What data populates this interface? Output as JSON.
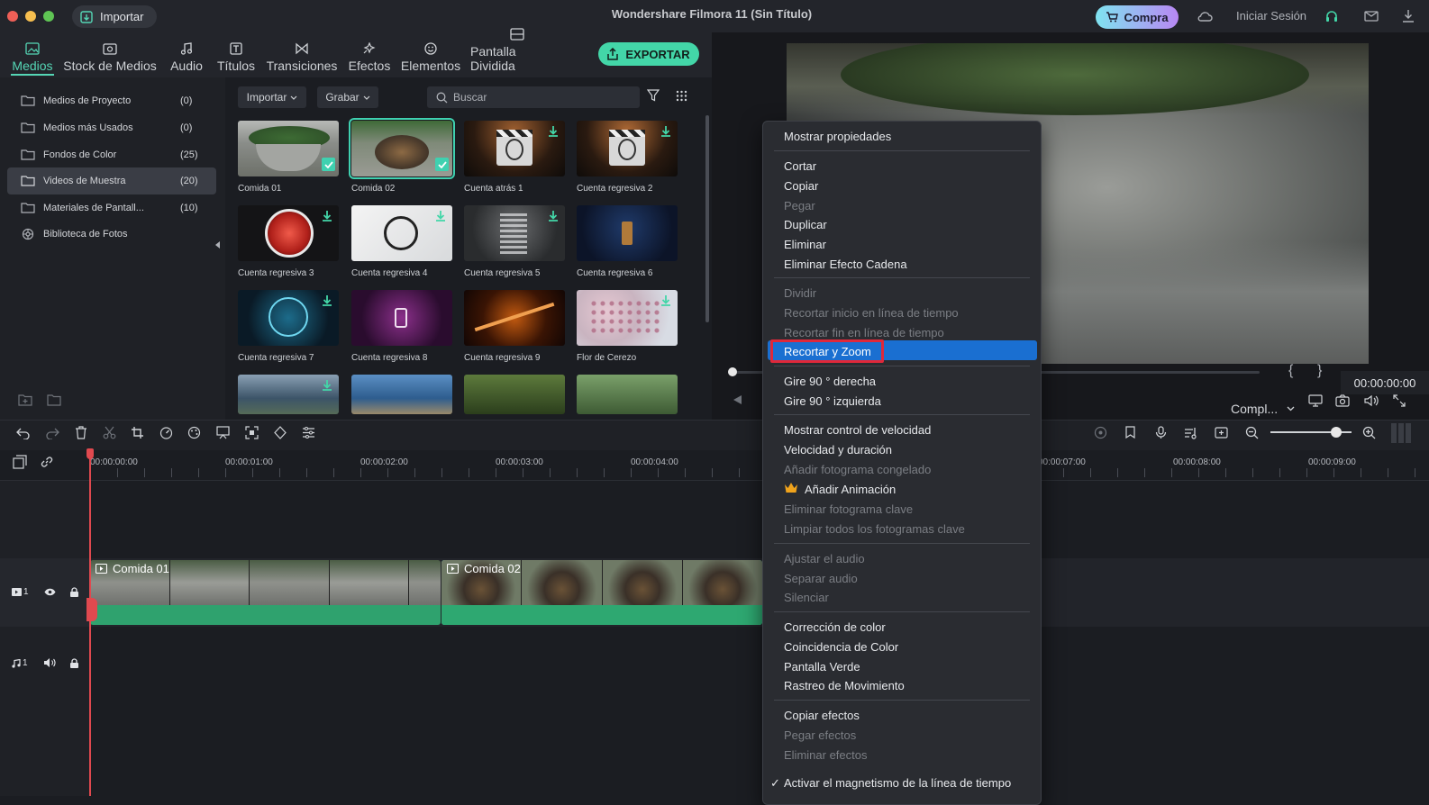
{
  "titlebar": {
    "import_label": "Importar",
    "app_title": "Wondershare Filmora 11 (Sin Título)",
    "buy_label": "Compra",
    "login_label": "Iniciar Sesión"
  },
  "nav": {
    "tabs": [
      {
        "label": "Medios",
        "icon": "media-icon"
      },
      {
        "label": "Stock de Medios",
        "icon": "stock-media-icon"
      },
      {
        "label": "Audio",
        "icon": "audio-icon"
      },
      {
        "label": "Títulos",
        "icon": "titles-icon"
      },
      {
        "label": "Transiciones",
        "icon": "transitions-icon"
      },
      {
        "label": "Efectos",
        "icon": "effects-icon"
      },
      {
        "label": "Elementos",
        "icon": "elements-icon"
      },
      {
        "label": "Pantalla Dividida",
        "icon": "split-screen-icon"
      }
    ],
    "export_label": "EXPORTAR"
  },
  "sidebar": {
    "items": [
      {
        "label": "Medios de Proyecto",
        "count": "(0)"
      },
      {
        "label": "Medios más Usados",
        "count": "(0)"
      },
      {
        "label": "Fondos de Color",
        "count": "(25)"
      },
      {
        "label": "Videos de Muestra",
        "count": "(20)"
      },
      {
        "label": "Materiales de Pantall...",
        "count": "(10)"
      },
      {
        "label": "Biblioteca de Fotos",
        "count": ""
      }
    ]
  },
  "media": {
    "import_dd": "Importar",
    "record_dd": "Grabar",
    "search_placeholder": "Buscar",
    "items": [
      {
        "caption": "Comida 01"
      },
      {
        "caption": "Comida 02"
      },
      {
        "caption": "Cuenta atrás 1"
      },
      {
        "caption": "Cuenta regresiva 2"
      },
      {
        "caption": "Cuenta regresiva 3"
      },
      {
        "caption": "Cuenta regresiva 4"
      },
      {
        "caption": "Cuenta regresiva 5"
      },
      {
        "caption": "Cuenta regresiva 6"
      },
      {
        "caption": "Cuenta regresiva 7"
      },
      {
        "caption": "Cuenta regresiva 8"
      },
      {
        "caption": "Cuenta regresiva 9"
      },
      {
        "caption": "Flor de Cerezo"
      }
    ]
  },
  "preview": {
    "timecode": "00:00:00:00",
    "quality": "Compl...",
    "bracket_in": "{",
    "bracket_out": "}"
  },
  "timeline": {
    "ticks": [
      "00:00:00:00",
      "00:00:01:00",
      "00:00:02:00",
      "00:00:03:00",
      "00:00:04:00",
      "00:00:07:00",
      "00:00:08:00",
      "00:00:09:00"
    ],
    "video_track_label": "1",
    "audio_track_label": "1",
    "clips": [
      {
        "title": "Comida 01"
      },
      {
        "title": "Comida 02"
      }
    ]
  },
  "context_menu": {
    "items": [
      {
        "label": "Mostrar propiedades",
        "enabled": true
      },
      {
        "label": "Cortar",
        "enabled": true
      },
      {
        "label": "Copiar",
        "enabled": true
      },
      {
        "label": "Pegar",
        "enabled": false
      },
      {
        "label": "Duplicar",
        "enabled": true
      },
      {
        "label": "Eliminar",
        "enabled": true
      },
      {
        "label": "Eliminar Efecto Cadena",
        "enabled": true
      },
      {
        "label": "Dividir",
        "enabled": false
      },
      {
        "label": "Recortar inicio en línea de tiempo",
        "enabled": false
      },
      {
        "label": "Recortar fin en línea de tiempo",
        "enabled": false
      },
      {
        "label": "Recortar y Zoom",
        "enabled": true,
        "highlighted": true
      },
      {
        "label": "Gire 90 ° derecha",
        "enabled": true
      },
      {
        "label": "Gire 90 ° izquierda",
        "enabled": true
      },
      {
        "label": "Mostrar control de velocidad",
        "enabled": true
      },
      {
        "label": "Velocidad y duración",
        "enabled": true
      },
      {
        "label": "Añadir fotograma congelado",
        "enabled": false
      },
      {
        "label": "Añadir Animación",
        "enabled": true,
        "icon": "crown-icon"
      },
      {
        "label": "Eliminar fotograma clave",
        "enabled": false
      },
      {
        "label": "Limpiar todos los fotogramas clave",
        "enabled": false
      },
      {
        "label": "Ajustar el audio",
        "enabled": false
      },
      {
        "label": "Separar audio",
        "enabled": false
      },
      {
        "label": "Silenciar",
        "enabled": false
      },
      {
        "label": "Corrección de color",
        "enabled": true
      },
      {
        "label": "Coincidencia de Color",
        "enabled": true
      },
      {
        "label": "Pantalla Verde",
        "enabled": true
      },
      {
        "label": "Rastreo de Movimiento",
        "enabled": true
      },
      {
        "label": "Copiar efectos",
        "enabled": true
      },
      {
        "label": "Pegar efectos",
        "enabled": false
      },
      {
        "label": "Eliminar efectos",
        "enabled": false
      },
      {
        "label": "Activar el magnetismo de la línea de tiempo",
        "enabled": true,
        "checked": true
      }
    ]
  },
  "colors": {
    "accent": "#43d6a8",
    "highlight": "#1a6fd1",
    "clip_green": "#2fa26e",
    "playhead": "#e0494f"
  }
}
